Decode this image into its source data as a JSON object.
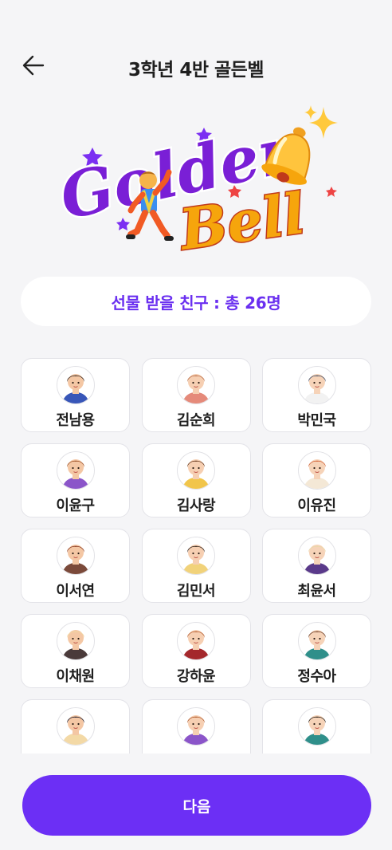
{
  "header": {
    "title": "3학년 4반 골든벨",
    "back_icon": "arrow-left-icon"
  },
  "logo": {
    "line1": "Golden",
    "line2": "Bell",
    "colors": {
      "golden": "#7a1fd6",
      "bell": "#f6a50c",
      "star_purple": "#7b2ff2",
      "star_red": "#ee4444",
      "sparkle": "#ffc93c"
    }
  },
  "banner": {
    "text": "선물 받을 친구 : 총 26명"
  },
  "students": [
    {
      "name": "전남용",
      "hair": "#3b2a22",
      "skin": "#f4c7a4",
      "shirt": "#3856b8"
    },
    {
      "name": "김순희",
      "hair": "#b86a44",
      "skin": "#f6cfb2",
      "shirt": "#e58a7a"
    },
    {
      "name": "박민국",
      "hair": "#3d4a63",
      "skin": "#f6d3b8",
      "shirt": "#f2f2f2"
    },
    {
      "name": "이윤구",
      "hair": "#a0552b",
      "skin": "#f4c7a4",
      "shirt": "#8b55c9"
    },
    {
      "name": "김사랑",
      "hair": "#6b3c21",
      "skin": "#f6cfb2",
      "shirt": "#f1c54a"
    },
    {
      "name": "이유진",
      "hair": "#d2643a",
      "skin": "#f6d3b8",
      "shirt": "#f4e8d6"
    },
    {
      "name": "이서연",
      "hair": "#8b3d25",
      "skin": "#f4c7a4",
      "shirt": "#7b4a3a"
    },
    {
      "name": "김민서",
      "hair": "#2d2018",
      "skin": "#f6cfb2",
      "shirt": "#f1d27a"
    },
    {
      "name": "최윤서",
      "hair": "#e8d7a8",
      "skin": "#f6d3b8",
      "shirt": "#5a3a8a"
    },
    {
      "name": "이채원",
      "hair": "#f0d6a0",
      "skin": "#f4c7a4",
      "shirt": "#4a3a3a"
    },
    {
      "name": "강하윤",
      "hair": "#b35a2c",
      "skin": "#f6cfb2",
      "shirt": "#a4282c"
    },
    {
      "name": "정수아",
      "hair": "#6a3a22",
      "skin": "#f6d3b8",
      "shirt": "#2f8f8a"
    },
    {
      "name": "",
      "hair": "#1f1a2a",
      "skin": "#f4c7a4",
      "shirt": "#f3d9a6"
    },
    {
      "name": "",
      "hair": "#b05a2b",
      "skin": "#f6cfb2",
      "shirt": "#8b55c9"
    },
    {
      "name": "",
      "hair": "#2a2018",
      "skin": "#f6d3b8",
      "shirt": "#2f8f8a"
    }
  ],
  "footer": {
    "next_label": "다음",
    "accent": "#6c2ff5"
  }
}
